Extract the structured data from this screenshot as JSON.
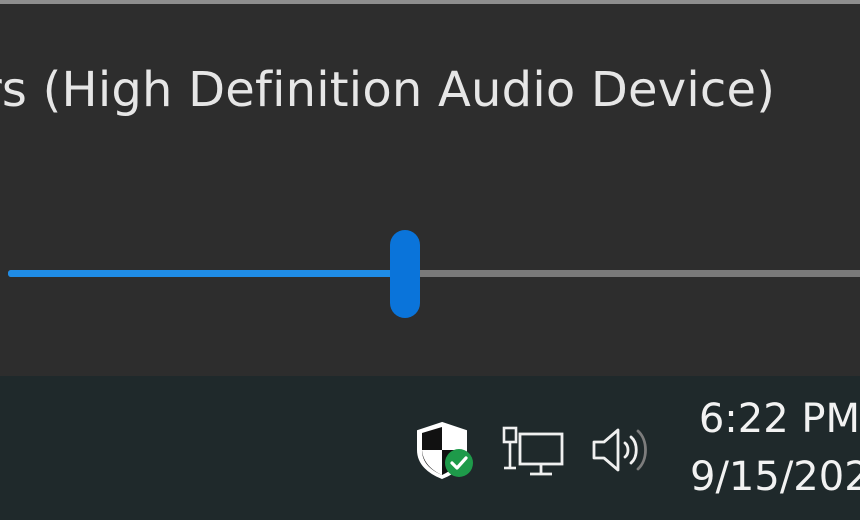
{
  "flyout": {
    "device_label": "rs (High Definition Audio Device)",
    "volume_percent": 46
  },
  "tray": {
    "icons": [
      "windows-security-icon",
      "network-icon",
      "speaker-icon"
    ],
    "time": "6:22 PM",
    "date": "9/15/202"
  },
  "colors": {
    "accent": "#0a74da",
    "slider_fill": "#1f8ce6",
    "flyout_bg": "#2d2d2d",
    "taskbar_bg": "#1f292b",
    "security_ok": "#1e9a4a"
  }
}
